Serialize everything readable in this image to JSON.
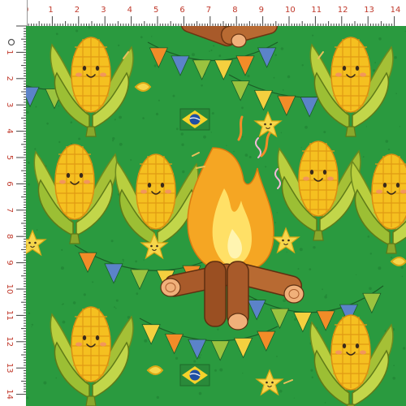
{
  "ruler": {
    "unit": "cm",
    "top_labels": [
      "0",
      "1",
      "2",
      "3",
      "4",
      "5",
      "6",
      "7",
      "8",
      "9",
      "10",
      "11",
      "12",
      "13",
      "14"
    ],
    "left_labels": [
      "1",
      "2",
      "3",
      "4",
      "5",
      "6",
      "7",
      "8",
      "9",
      "10",
      "11",
      "12",
      "13",
      "14"
    ]
  },
  "colors": {
    "background": "#2a9a3f",
    "corn_kernel": "#f5c020",
    "corn_husk": "#a8c33a",
    "flame_outer": "#f5a623",
    "flame_inner": "#ffe066",
    "log": "#a85a2a",
    "flag_green": "#2a8a3a",
    "flag_yellow": "#f6d22a",
    "flag_blue": "#1f4fa3",
    "bunting": [
      "#f28c28",
      "#5b83c9",
      "#9bc33f",
      "#f4d03f"
    ]
  },
  "icons": [
    "corn-character-icon",
    "campfire-icon",
    "brazil-flag-icon",
    "star-character-icon",
    "bunting-flag-icon"
  ]
}
